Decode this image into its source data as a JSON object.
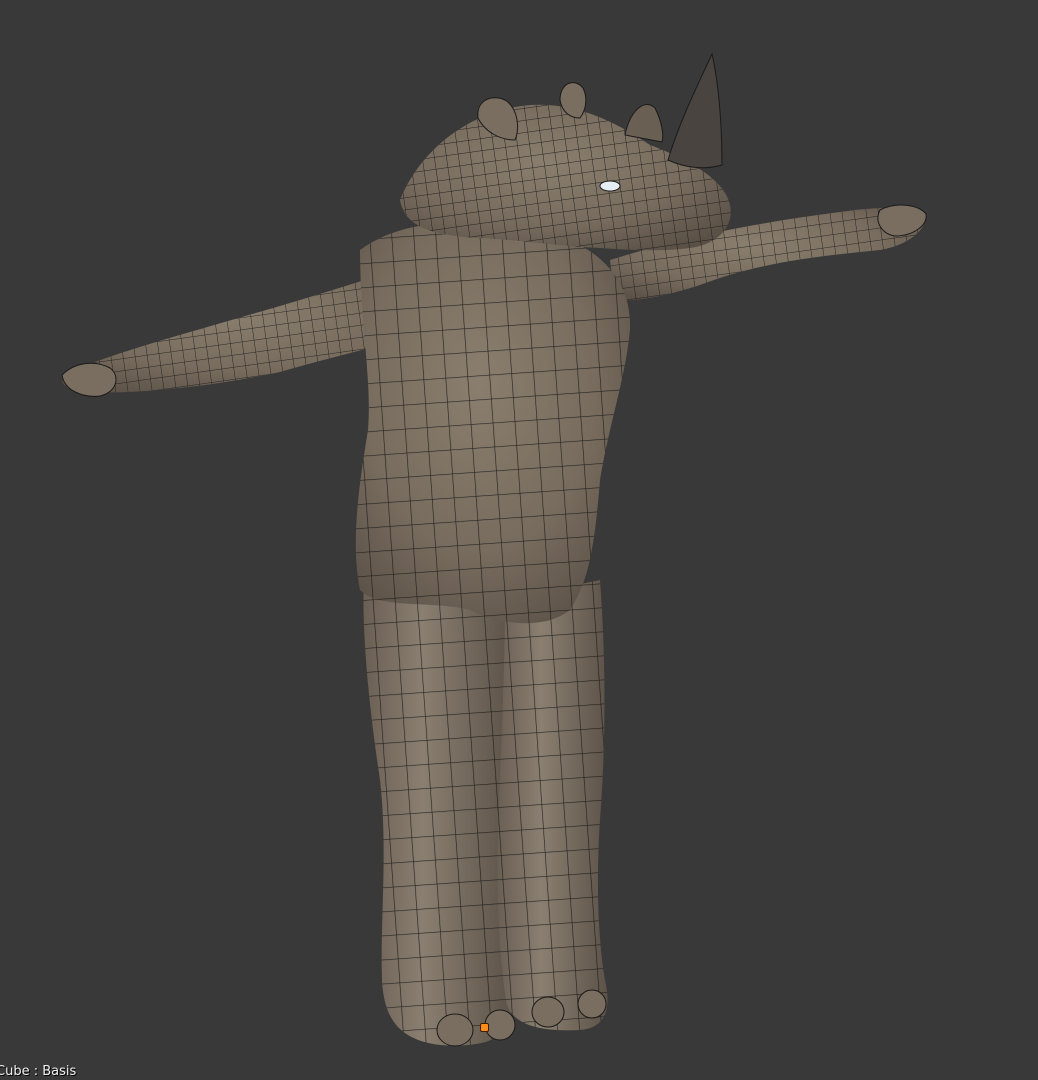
{
  "viewport": {
    "background_color": "#393939",
    "object_label": "Cube : Basis",
    "mesh": {
      "surface_color": "#786c5e",
      "wire_color": "#1a1a1a",
      "origin_color": "#ff8c1a"
    }
  }
}
